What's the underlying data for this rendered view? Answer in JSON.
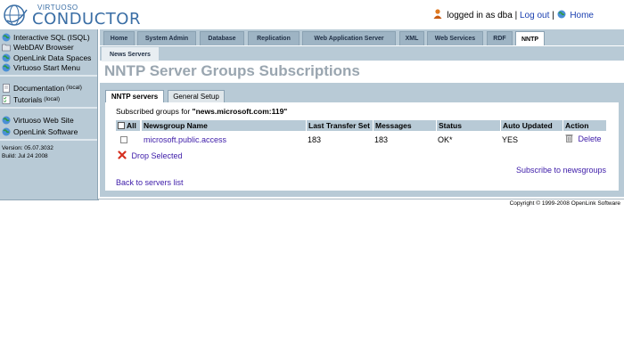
{
  "logo": {
    "small": "VIRTUOSO",
    "big": "CONDUCTOR"
  },
  "user": {
    "logged_in_text": "logged in as dba",
    "separator": "|",
    "logout": "Log out",
    "home": "Home"
  },
  "sidebar": {
    "groups": [
      {
        "items": [
          {
            "label": "Interactive SQL (ISQL)",
            "icon": "globe-icon",
            "note": ""
          },
          {
            "label": "WebDAV Browser",
            "icon": "folder-icon",
            "note": ""
          },
          {
            "label": "OpenLink Data Spaces",
            "icon": "globe-icon",
            "note": ""
          },
          {
            "label": "Virtuoso Start Menu",
            "icon": "globe-icon",
            "note": ""
          }
        ]
      },
      {
        "items": [
          {
            "label": "Documentation",
            "icon": "document-icon",
            "note": "(local)"
          },
          {
            "label": "Tutorials",
            "icon": "checklist-icon",
            "note": "(local)"
          }
        ]
      },
      {
        "items": [
          {
            "label": "Virtuoso Web Site",
            "icon": "globe-icon",
            "note": ""
          },
          {
            "label": "OpenLink Software",
            "icon": "globe-icon",
            "note": ""
          }
        ]
      }
    ],
    "version": "Version: 05.07.3032",
    "build": "Build: Jul 24 2008"
  },
  "tabs": [
    "Home",
    "System Admin",
    "Database",
    "Replication",
    "Web Application Server",
    "XML",
    "Web Services",
    "RDF",
    "NNTP"
  ],
  "active_tab": "NNTP",
  "subtab": "News Servers",
  "page_title": "NNTP Server Groups Subscriptions",
  "panel_tabs": {
    "active": "NNTP servers",
    "inactive": "General Setup"
  },
  "subscribed_prefix": "Subscribed groups for",
  "server": "\"news.microsoft.com:119\"",
  "table": {
    "all_label": "All",
    "headers": [
      "Newsgroup Name",
      "Last Transfer Set",
      "Messages",
      "Status",
      "Auto Updated",
      "Action"
    ],
    "rows": [
      {
        "name": "microsoft.public.access",
        "last_transfer": "183",
        "messages": "183",
        "status": "OK*",
        "auto_updated": "YES",
        "action": "Delete"
      }
    ]
  },
  "drop_selected": "Drop Selected",
  "subscribe_link": "Subscribe to newsgroups",
  "back_link": "Back to servers list",
  "copyright": "Copyright © 1999-2008 OpenLink Software",
  "colors": {
    "nav_bg": "#b8cad6",
    "link": "#3c1aa8",
    "title": "#9aa6b0",
    "logo": "#3a6ea5"
  }
}
